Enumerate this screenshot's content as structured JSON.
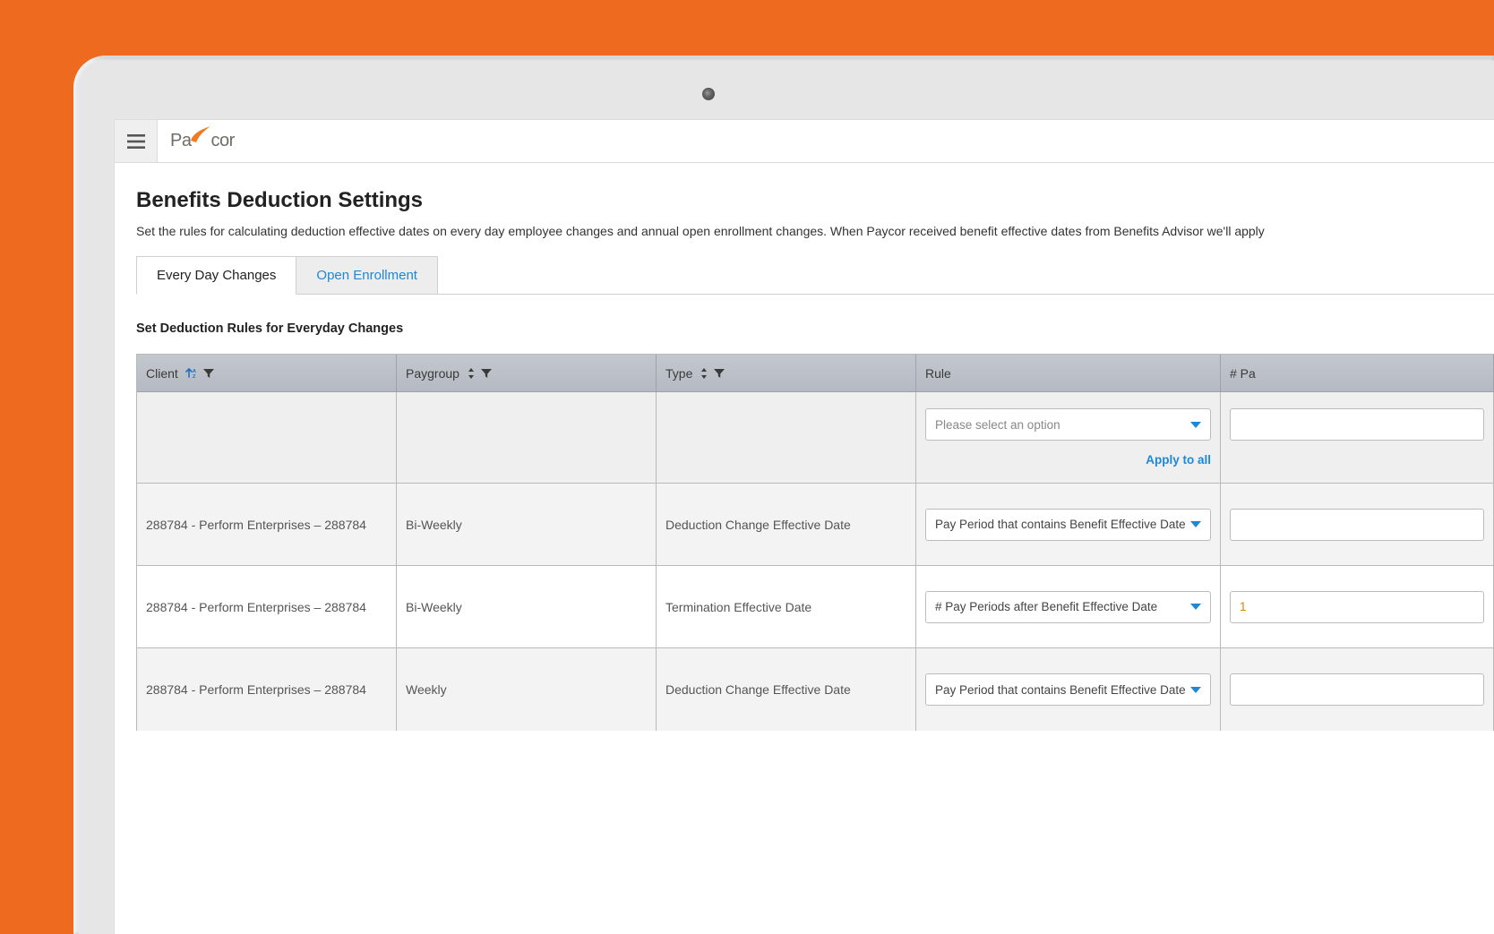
{
  "brand": {
    "name_a": "Pa",
    "name_b": "cor"
  },
  "page": {
    "title": "Benefits Deduction Settings",
    "description": "Set the rules for calculating deduction effective dates on every day employee changes and annual open enrollment changes. When Paycor received benefit effective dates from Benefits Advisor we'll apply"
  },
  "tabs": {
    "everyday": "Every Day Changes",
    "open_enrollment": "Open Enrollment"
  },
  "section": {
    "label": "Set Deduction Rules for Everyday Changes"
  },
  "table": {
    "headers": {
      "client": "Client",
      "paygroup": "Paygroup",
      "type": "Type",
      "rule": "Rule",
      "payperiods": "# Pa"
    },
    "filter_row": {
      "rule_placeholder": "Please select an option",
      "apply_all": "Apply to all"
    },
    "rows": [
      {
        "client": "288784 - Perform Enterprises – 288784",
        "paygroup": "Bi-Weekly",
        "type": "Deduction Change Effective Date",
        "rule": "Pay Period that contains Benefit Effective Date",
        "pp": ""
      },
      {
        "client": "288784 - Perform Enterprises – 288784",
        "paygroup": "Bi-Weekly",
        "type": "Termination Effective Date",
        "rule": "# Pay Periods after Benefit Effective Date",
        "pp": "1"
      },
      {
        "client": "288784 - Perform Enterprises – 288784",
        "paygroup": "Weekly",
        "type": "Deduction Change Effective Date",
        "rule": "Pay Period that contains Benefit Effective Date",
        "pp": ""
      }
    ]
  }
}
